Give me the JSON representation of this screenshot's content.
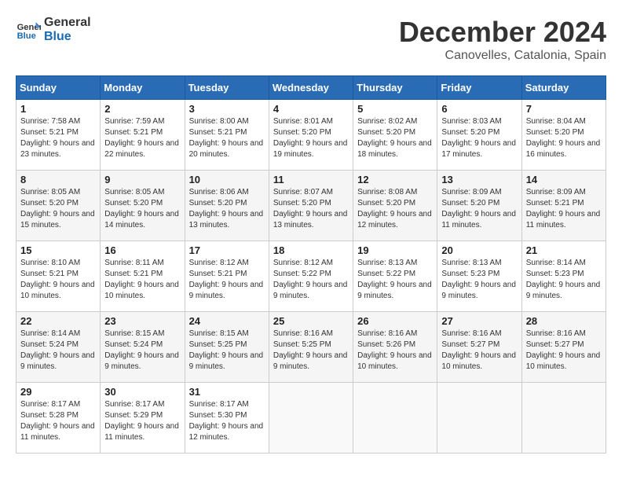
{
  "logo": {
    "line1": "General",
    "line2": "Blue"
  },
  "title": "December 2024",
  "subtitle": "Canovelles, Catalonia, Spain",
  "days_of_week": [
    "Sunday",
    "Monday",
    "Tuesday",
    "Wednesday",
    "Thursday",
    "Friday",
    "Saturday"
  ],
  "weeks": [
    [
      {
        "day": "1",
        "sunrise": "7:58 AM",
        "sunset": "5:21 PM",
        "daylight": "9 hours and 23 minutes."
      },
      {
        "day": "2",
        "sunrise": "7:59 AM",
        "sunset": "5:21 PM",
        "daylight": "9 hours and 22 minutes."
      },
      {
        "day": "3",
        "sunrise": "8:00 AM",
        "sunset": "5:21 PM",
        "daylight": "9 hours and 20 minutes."
      },
      {
        "day": "4",
        "sunrise": "8:01 AM",
        "sunset": "5:20 PM",
        "daylight": "9 hours and 19 minutes."
      },
      {
        "day": "5",
        "sunrise": "8:02 AM",
        "sunset": "5:20 PM",
        "daylight": "9 hours and 18 minutes."
      },
      {
        "day": "6",
        "sunrise": "8:03 AM",
        "sunset": "5:20 PM",
        "daylight": "9 hours and 17 minutes."
      },
      {
        "day": "7",
        "sunrise": "8:04 AM",
        "sunset": "5:20 PM",
        "daylight": "9 hours and 16 minutes."
      }
    ],
    [
      {
        "day": "8",
        "sunrise": "8:05 AM",
        "sunset": "5:20 PM",
        "daylight": "9 hours and 15 minutes."
      },
      {
        "day": "9",
        "sunrise": "8:05 AM",
        "sunset": "5:20 PM",
        "daylight": "9 hours and 14 minutes."
      },
      {
        "day": "10",
        "sunrise": "8:06 AM",
        "sunset": "5:20 PM",
        "daylight": "9 hours and 13 minutes."
      },
      {
        "day": "11",
        "sunrise": "8:07 AM",
        "sunset": "5:20 PM",
        "daylight": "9 hours and 13 minutes."
      },
      {
        "day": "12",
        "sunrise": "8:08 AM",
        "sunset": "5:20 PM",
        "daylight": "9 hours and 12 minutes."
      },
      {
        "day": "13",
        "sunrise": "8:09 AM",
        "sunset": "5:20 PM",
        "daylight": "9 hours and 11 minutes."
      },
      {
        "day": "14",
        "sunrise": "8:09 AM",
        "sunset": "5:21 PM",
        "daylight": "9 hours and 11 minutes."
      }
    ],
    [
      {
        "day": "15",
        "sunrise": "8:10 AM",
        "sunset": "5:21 PM",
        "daylight": "9 hours and 10 minutes."
      },
      {
        "day": "16",
        "sunrise": "8:11 AM",
        "sunset": "5:21 PM",
        "daylight": "9 hours and 10 minutes."
      },
      {
        "day": "17",
        "sunrise": "8:12 AM",
        "sunset": "5:21 PM",
        "daylight": "9 hours and 9 minutes."
      },
      {
        "day": "18",
        "sunrise": "8:12 AM",
        "sunset": "5:22 PM",
        "daylight": "9 hours and 9 minutes."
      },
      {
        "day": "19",
        "sunrise": "8:13 AM",
        "sunset": "5:22 PM",
        "daylight": "9 hours and 9 minutes."
      },
      {
        "day": "20",
        "sunrise": "8:13 AM",
        "sunset": "5:23 PM",
        "daylight": "9 hours and 9 minutes."
      },
      {
        "day": "21",
        "sunrise": "8:14 AM",
        "sunset": "5:23 PM",
        "daylight": "9 hours and 9 minutes."
      }
    ],
    [
      {
        "day": "22",
        "sunrise": "8:14 AM",
        "sunset": "5:24 PM",
        "daylight": "9 hours and 9 minutes."
      },
      {
        "day": "23",
        "sunrise": "8:15 AM",
        "sunset": "5:24 PM",
        "daylight": "9 hours and 9 minutes."
      },
      {
        "day": "24",
        "sunrise": "8:15 AM",
        "sunset": "5:25 PM",
        "daylight": "9 hours and 9 minutes."
      },
      {
        "day": "25",
        "sunrise": "8:16 AM",
        "sunset": "5:25 PM",
        "daylight": "9 hours and 9 minutes."
      },
      {
        "day": "26",
        "sunrise": "8:16 AM",
        "sunset": "5:26 PM",
        "daylight": "9 hours and 10 minutes."
      },
      {
        "day": "27",
        "sunrise": "8:16 AM",
        "sunset": "5:27 PM",
        "daylight": "9 hours and 10 minutes."
      },
      {
        "day": "28",
        "sunrise": "8:16 AM",
        "sunset": "5:27 PM",
        "daylight": "9 hours and 10 minutes."
      }
    ],
    [
      {
        "day": "29",
        "sunrise": "8:17 AM",
        "sunset": "5:28 PM",
        "daylight": "9 hours and 11 minutes."
      },
      {
        "day": "30",
        "sunrise": "8:17 AM",
        "sunset": "5:29 PM",
        "daylight": "9 hours and 11 minutes."
      },
      {
        "day": "31",
        "sunrise": "8:17 AM",
        "sunset": "5:30 PM",
        "daylight": "9 hours and 12 minutes."
      },
      null,
      null,
      null,
      null
    ]
  ]
}
